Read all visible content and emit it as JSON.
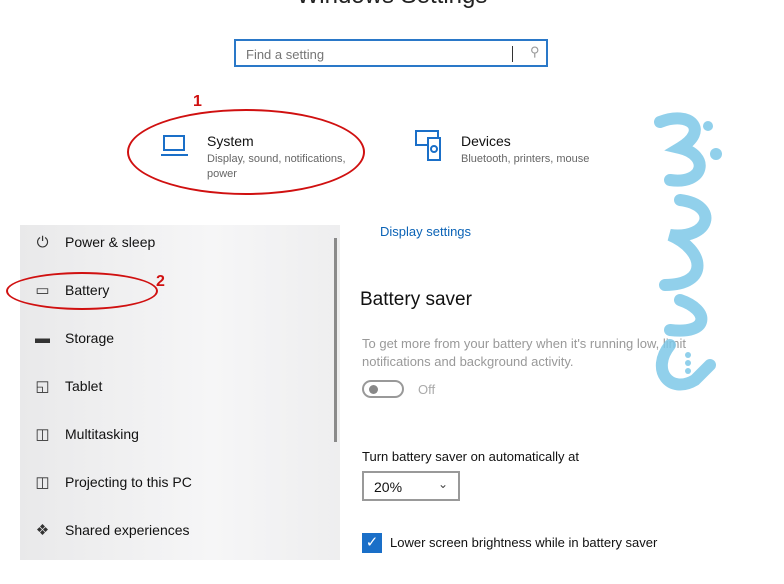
{
  "window_title": "Windows Settings",
  "search": {
    "placeholder": "Find a setting",
    "icon": "search-icon"
  },
  "categories": [
    {
      "title": "System",
      "subtitle": "Display, sound, notifications, power",
      "icon": "laptop-icon"
    },
    {
      "title": "Devices",
      "subtitle": "Bluetooth, printers, mouse",
      "icon": "devices-icon"
    }
  ],
  "annotations": [
    "1",
    "2"
  ],
  "sidebar": {
    "items": [
      {
        "label": "Power & sleep",
        "icon": "power-icon"
      },
      {
        "label": "Battery",
        "icon": "battery-icon"
      },
      {
        "label": "Storage",
        "icon": "storage-icon"
      },
      {
        "label": "Tablet",
        "icon": "tablet-icon"
      },
      {
        "label": "Multitasking",
        "icon": "multitasking-icon"
      },
      {
        "label": "Projecting to this PC",
        "icon": "projecting-icon"
      },
      {
        "label": "Shared experiences",
        "icon": "shared-experiences-icon"
      }
    ]
  },
  "main": {
    "display_settings_link": "Display settings",
    "heading": "Battery saver",
    "description": "To get more from your battery when it's running low, limit notifications and background activity.",
    "toggle": {
      "state": "Off",
      "on": false
    },
    "threshold_label": "Turn battery saver on automatically at",
    "threshold_value": "20%",
    "brightness_checkbox": {
      "label": "Lower screen brightness while in battery saver",
      "checked": true
    }
  },
  "colors": {
    "accent": "#1a6fc8",
    "link": "#0b63b6",
    "annotation": "#d01010",
    "watermark": "#7ec8e8"
  }
}
